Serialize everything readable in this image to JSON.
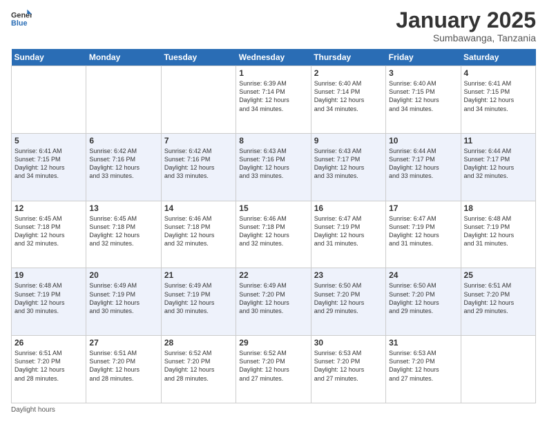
{
  "header": {
    "logo_general": "General",
    "logo_blue": "Blue",
    "title": "January 2025",
    "subtitle": "Sumbawanga, Tanzania"
  },
  "days_of_week": [
    "Sunday",
    "Monday",
    "Tuesday",
    "Wednesday",
    "Thursday",
    "Friday",
    "Saturday"
  ],
  "weeks": [
    [
      {
        "date": "",
        "info": ""
      },
      {
        "date": "",
        "info": ""
      },
      {
        "date": "",
        "info": ""
      },
      {
        "date": "1",
        "info": "Sunrise: 6:39 AM\nSunset: 7:14 PM\nDaylight: 12 hours\nand 34 minutes."
      },
      {
        "date": "2",
        "info": "Sunrise: 6:40 AM\nSunset: 7:14 PM\nDaylight: 12 hours\nand 34 minutes."
      },
      {
        "date": "3",
        "info": "Sunrise: 6:40 AM\nSunset: 7:15 PM\nDaylight: 12 hours\nand 34 minutes."
      },
      {
        "date": "4",
        "info": "Sunrise: 6:41 AM\nSunset: 7:15 PM\nDaylight: 12 hours\nand 34 minutes."
      }
    ],
    [
      {
        "date": "5",
        "info": "Sunrise: 6:41 AM\nSunset: 7:15 PM\nDaylight: 12 hours\nand 34 minutes."
      },
      {
        "date": "6",
        "info": "Sunrise: 6:42 AM\nSunset: 7:16 PM\nDaylight: 12 hours\nand 33 minutes."
      },
      {
        "date": "7",
        "info": "Sunrise: 6:42 AM\nSunset: 7:16 PM\nDaylight: 12 hours\nand 33 minutes."
      },
      {
        "date": "8",
        "info": "Sunrise: 6:43 AM\nSunset: 7:16 PM\nDaylight: 12 hours\nand 33 minutes."
      },
      {
        "date": "9",
        "info": "Sunrise: 6:43 AM\nSunset: 7:17 PM\nDaylight: 12 hours\nand 33 minutes."
      },
      {
        "date": "10",
        "info": "Sunrise: 6:44 AM\nSunset: 7:17 PM\nDaylight: 12 hours\nand 33 minutes."
      },
      {
        "date": "11",
        "info": "Sunrise: 6:44 AM\nSunset: 7:17 PM\nDaylight: 12 hours\nand 32 minutes."
      }
    ],
    [
      {
        "date": "12",
        "info": "Sunrise: 6:45 AM\nSunset: 7:18 PM\nDaylight: 12 hours\nand 32 minutes."
      },
      {
        "date": "13",
        "info": "Sunrise: 6:45 AM\nSunset: 7:18 PM\nDaylight: 12 hours\nand 32 minutes."
      },
      {
        "date": "14",
        "info": "Sunrise: 6:46 AM\nSunset: 7:18 PM\nDaylight: 12 hours\nand 32 minutes."
      },
      {
        "date": "15",
        "info": "Sunrise: 6:46 AM\nSunset: 7:18 PM\nDaylight: 12 hours\nand 32 minutes."
      },
      {
        "date": "16",
        "info": "Sunrise: 6:47 AM\nSunset: 7:19 PM\nDaylight: 12 hours\nand 31 minutes."
      },
      {
        "date": "17",
        "info": "Sunrise: 6:47 AM\nSunset: 7:19 PM\nDaylight: 12 hours\nand 31 minutes."
      },
      {
        "date": "18",
        "info": "Sunrise: 6:48 AM\nSunset: 7:19 PM\nDaylight: 12 hours\nand 31 minutes."
      }
    ],
    [
      {
        "date": "19",
        "info": "Sunrise: 6:48 AM\nSunset: 7:19 PM\nDaylight: 12 hours\nand 30 minutes."
      },
      {
        "date": "20",
        "info": "Sunrise: 6:49 AM\nSunset: 7:19 PM\nDaylight: 12 hours\nand 30 minutes."
      },
      {
        "date": "21",
        "info": "Sunrise: 6:49 AM\nSunset: 7:19 PM\nDaylight: 12 hours\nand 30 minutes."
      },
      {
        "date": "22",
        "info": "Sunrise: 6:49 AM\nSunset: 7:20 PM\nDaylight: 12 hours\nand 30 minutes."
      },
      {
        "date": "23",
        "info": "Sunrise: 6:50 AM\nSunset: 7:20 PM\nDaylight: 12 hours\nand 29 minutes."
      },
      {
        "date": "24",
        "info": "Sunrise: 6:50 AM\nSunset: 7:20 PM\nDaylight: 12 hours\nand 29 minutes."
      },
      {
        "date": "25",
        "info": "Sunrise: 6:51 AM\nSunset: 7:20 PM\nDaylight: 12 hours\nand 29 minutes."
      }
    ],
    [
      {
        "date": "26",
        "info": "Sunrise: 6:51 AM\nSunset: 7:20 PM\nDaylight: 12 hours\nand 28 minutes."
      },
      {
        "date": "27",
        "info": "Sunrise: 6:51 AM\nSunset: 7:20 PM\nDaylight: 12 hours\nand 28 minutes."
      },
      {
        "date": "28",
        "info": "Sunrise: 6:52 AM\nSunset: 7:20 PM\nDaylight: 12 hours\nand 28 minutes."
      },
      {
        "date": "29",
        "info": "Sunrise: 6:52 AM\nSunset: 7:20 PM\nDaylight: 12 hours\nand 27 minutes."
      },
      {
        "date": "30",
        "info": "Sunrise: 6:53 AM\nSunset: 7:20 PM\nDaylight: 12 hours\nand 27 minutes."
      },
      {
        "date": "31",
        "info": "Sunrise: 6:53 AM\nSunset: 7:20 PM\nDaylight: 12 hours\nand 27 minutes."
      },
      {
        "date": "",
        "info": ""
      }
    ]
  ],
  "footer": {
    "daylight_label": "Daylight hours"
  }
}
